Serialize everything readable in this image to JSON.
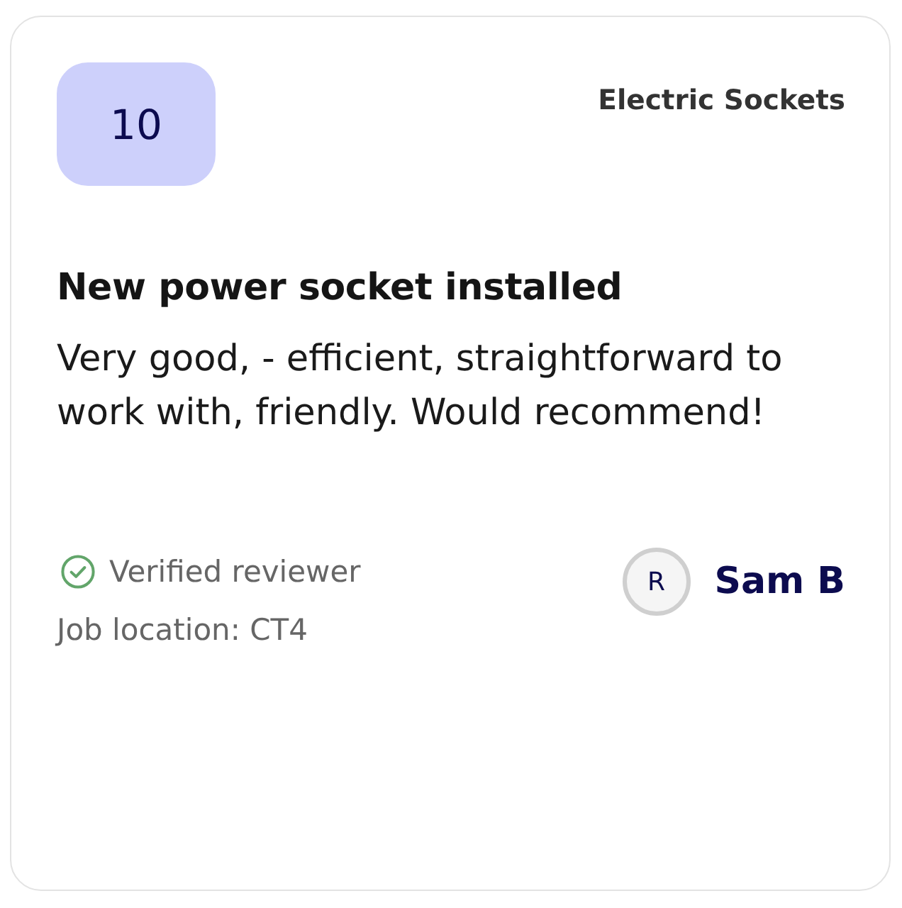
{
  "card": {
    "score": "10",
    "category": "Electric Sockets",
    "title": "New power socket installed",
    "body": "Very good, - efficient, straightforward to work with, friendly. Would recommend!",
    "verified": true,
    "verified_label": "Verified reviewer",
    "location": "Job location: CT4",
    "reviewer": {
      "initial": "R",
      "name": "Sam B"
    }
  }
}
